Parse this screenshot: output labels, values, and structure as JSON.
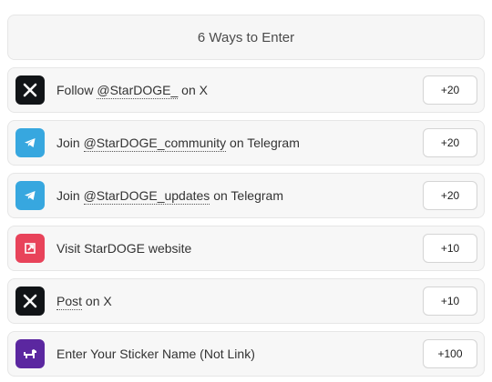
{
  "header": {
    "title": "6 Ways to Enter"
  },
  "entries": [
    {
      "icon": "x-logo-icon",
      "pre": "Follow ",
      "link": "@StarDOGE_",
      "post": " on X",
      "points": "+20"
    },
    {
      "icon": "telegram-icon",
      "pre": "Join ",
      "link": "@StarDOGE_community",
      "post": " on Telegram",
      "points": "+20"
    },
    {
      "icon": "telegram-icon",
      "pre": "Join ",
      "link": "@StarDOGE_updates",
      "post": " on Telegram",
      "points": "+20"
    },
    {
      "icon": "external-link-icon",
      "pre": "Visit StarDOGE website",
      "link": "",
      "post": "",
      "points": "+10"
    },
    {
      "icon": "x-logo-icon",
      "pre": "",
      "link": "Post",
      "post": " on X",
      "points": "+10"
    },
    {
      "icon": "dog-icon",
      "pre": "Enter Your Sticker Name (Not Link)",
      "link": "",
      "post": "",
      "points": "+100"
    }
  ],
  "colors": {
    "x": "#111417",
    "telegram": "#37a7df",
    "visit": "#e8435a",
    "custom": "#5b27a0"
  }
}
